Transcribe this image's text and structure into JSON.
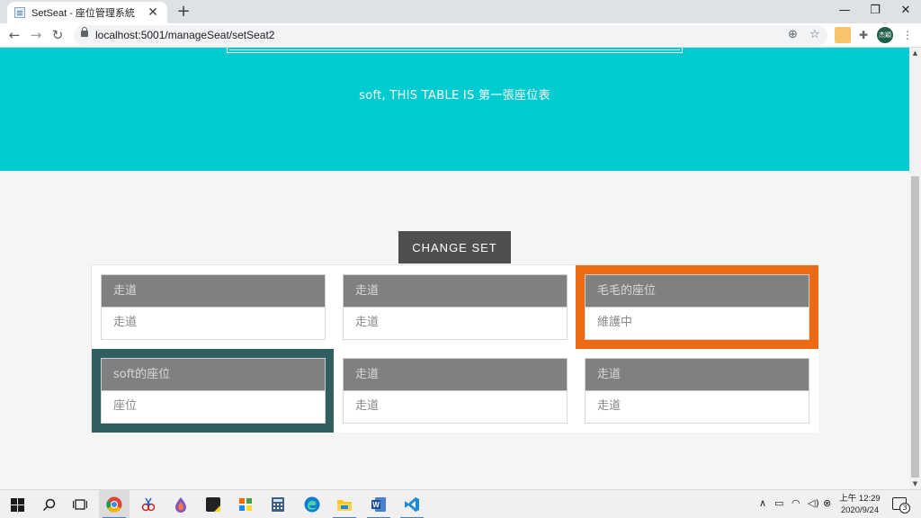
{
  "browser": {
    "tab_title": "SetSeat - 座位管理系統",
    "tab_close": "✕",
    "new_tab": "+",
    "url": "localhost:5001/manageSeat/setSeat2",
    "avatar_text": "杰穎",
    "window_controls": {
      "minimize": "—",
      "restore": "❐",
      "close": "✕"
    },
    "nav": {
      "back": "←",
      "forward": "→",
      "reload": "↻"
    }
  },
  "page": {
    "hero_text": "soft, THIS TABLE IS 第一張座位表",
    "change_set_label": "CHANGE SET",
    "seats": [
      {
        "title": "走道",
        "status": "走道",
        "highlight": "none"
      },
      {
        "title": "走道",
        "status": "走道",
        "highlight": "none"
      },
      {
        "title": "毛毛的座位",
        "status": "維護中",
        "highlight": "orange"
      },
      {
        "title": "soft的座位",
        "status": "座位",
        "highlight": "teal"
      },
      {
        "title": "走道",
        "status": "走道",
        "highlight": "none"
      },
      {
        "title": "走道",
        "status": "走道",
        "highlight": "none"
      }
    ]
  },
  "colors": {
    "hero": "#00cbd1",
    "button": "#4f4f4f",
    "orange_highlight": "#ec6b12",
    "teal_highlight": "#2f5f5f",
    "seat_header": "#808080"
  },
  "taskbar": {
    "icons": [
      "windows-start-icon",
      "search-icon",
      "task-view-icon",
      "chrome-icon",
      "snipping-tool-icon",
      "paint-icon",
      "sticky-notes-icon",
      "app-icon",
      "calculator-icon",
      "edge-icon",
      "file-explorer-icon",
      "word-icon",
      "vscode-icon"
    ],
    "clock_time": "上午 12:29",
    "clock_date": "2020/9/24",
    "notification_count": "3"
  }
}
